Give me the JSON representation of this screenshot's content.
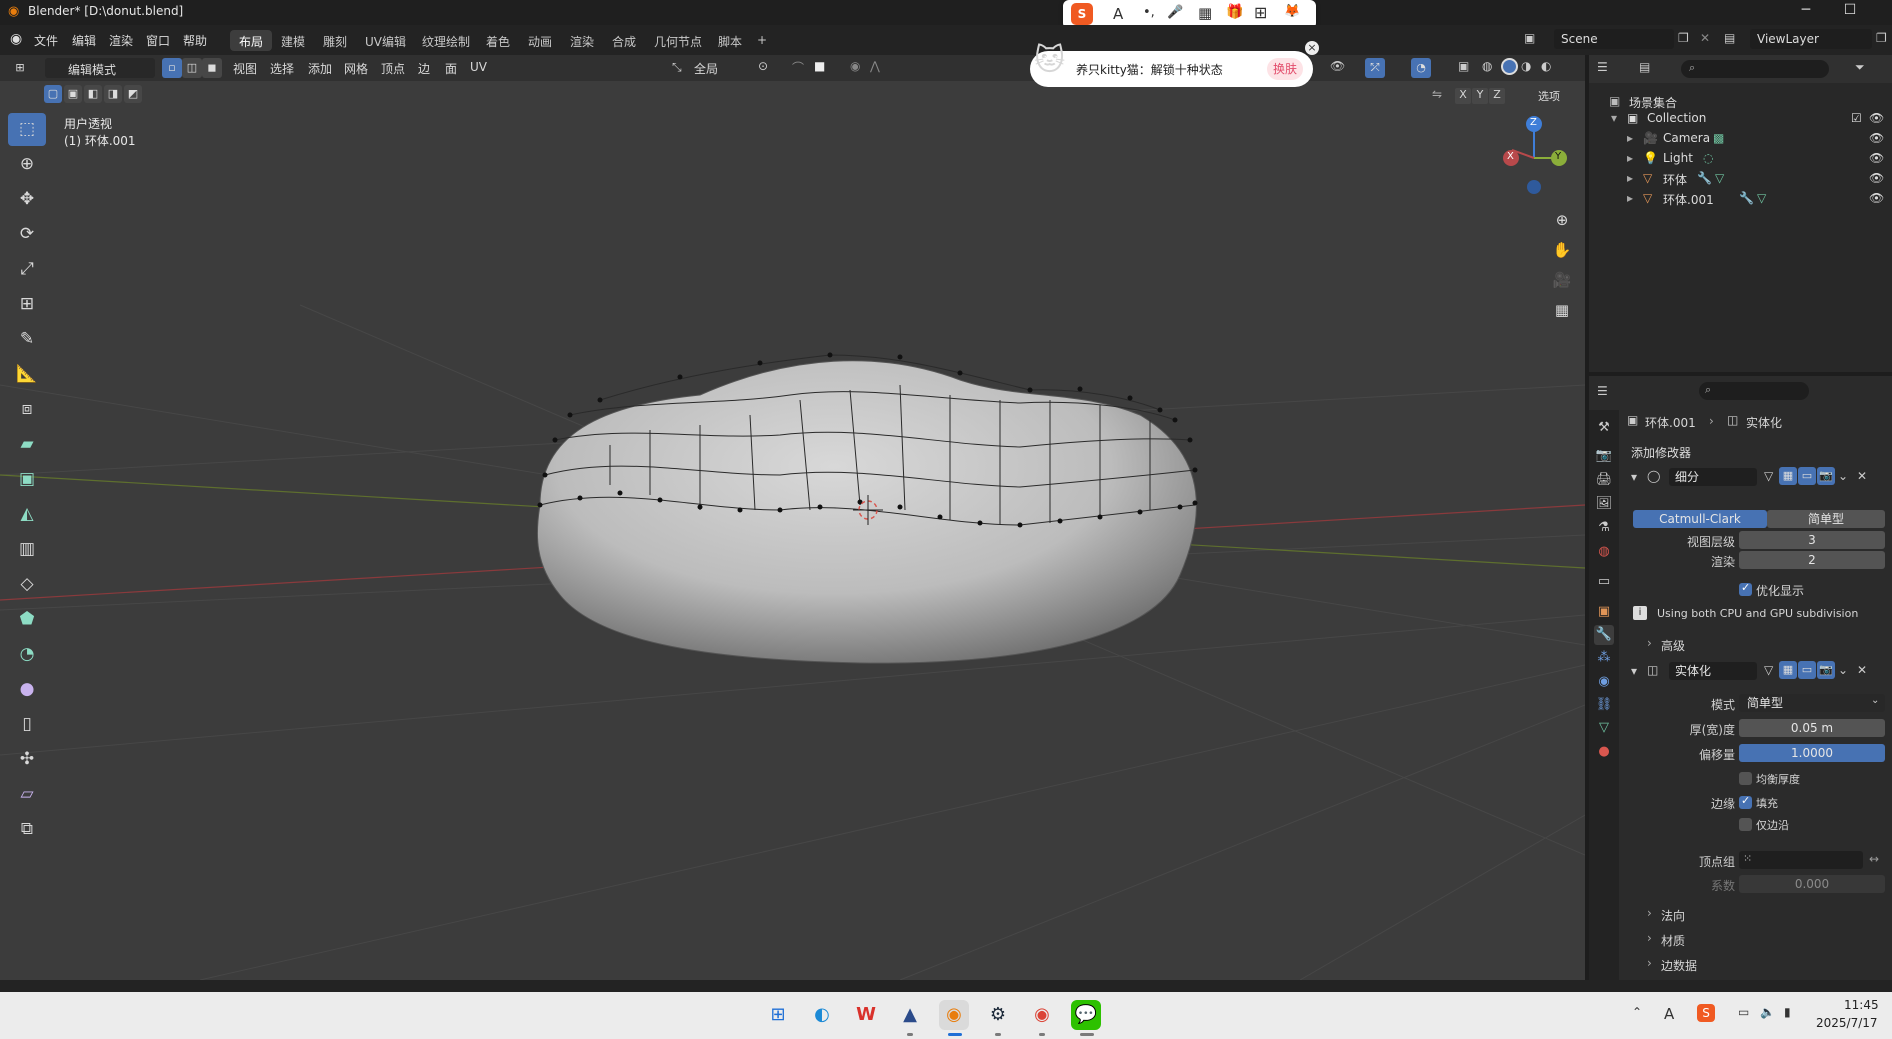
{
  "window": {
    "title": "Blender* [D:\\donut.blend]",
    "minimize": "─",
    "maximize": "☐",
    "close": "✕"
  },
  "menu": {
    "items": [
      "文件",
      "编辑",
      "渲染",
      "窗口",
      "帮助"
    ],
    "workspaces": [
      "布局",
      "建模",
      "雕刻",
      "UV编辑",
      "纹理绘制",
      "着色",
      "动画",
      "渲染",
      "合成",
      "几何节点",
      "脚本"
    ],
    "active_workspace": "布局",
    "add_tab": "+",
    "scene": "Scene",
    "view_layer": "ViewLayer"
  },
  "ime": {
    "chars": [
      "A",
      "•,",
      "🎤",
      "▦",
      "🎁",
      "⊞",
      "🦊"
    ]
  },
  "ad": {
    "text": "养只kitty猫：解锁十种状态",
    "button": "换肤",
    "close": "×"
  },
  "viewport_header": {
    "mode": "编辑模式",
    "menus": [
      "视图",
      "选择",
      "添加",
      "网格",
      "顶点",
      "边",
      "面",
      "UV"
    ],
    "orientation": "全局",
    "options": "选项",
    "axes": [
      "X",
      "Y",
      "Z"
    ]
  },
  "viewport": {
    "view_name": "用户透视",
    "object_info": "(1) 环体.001",
    "gizmo": {
      "z": "Z",
      "y": "Y",
      "x": "X"
    }
  },
  "outliner": {
    "root": "场景集合",
    "collection": "Collection",
    "items": [
      {
        "name": "Camera"
      },
      {
        "name": "Light"
      },
      {
        "name": "环体"
      },
      {
        "name": "环体.001"
      }
    ]
  },
  "properties": {
    "breadcrumb_object": "环体.001",
    "breadcrumb_modifier": "实体化",
    "add_modifier": "添加修改器",
    "subdivision": {
      "name": "细分",
      "type_a": "Catmull-Clark",
      "type_b": "简单型",
      "levels_viewport_label": "视图层级",
      "levels_viewport": "3",
      "render_label": "渲染",
      "render": "2",
      "optimal_display": "优化显示",
      "info": "Using both CPU and GPU subdivision",
      "advanced": "高级"
    },
    "solidify": {
      "name": "实体化",
      "mode_label": "模式",
      "mode": "简单型",
      "thickness_label": "厚(宽)度",
      "thickness": "0.05 m",
      "offset_label": "偏移量",
      "offset": "1.0000",
      "even_thickness": "均衡厚度",
      "rim_label": "边缘",
      "fill": "填充",
      "only_rim": "仅边沿",
      "vertex_group_label": "顶点组",
      "factor_label": "系数",
      "factor": "0.000",
      "normals": "法向",
      "materials": "材质",
      "edge_data": "边数据"
    }
  },
  "taskbar": {
    "time": "11:45",
    "date": "2025/7/17",
    "ime_char": "A"
  },
  "colors": {
    "accent": "#4772b3",
    "viewport_bg": "#3c3c3c",
    "mesh_body": "#c6c6c6",
    "axis_x": "#b8494b",
    "axis_y": "#8bae3a",
    "axis_z": "#3f7ed8"
  }
}
